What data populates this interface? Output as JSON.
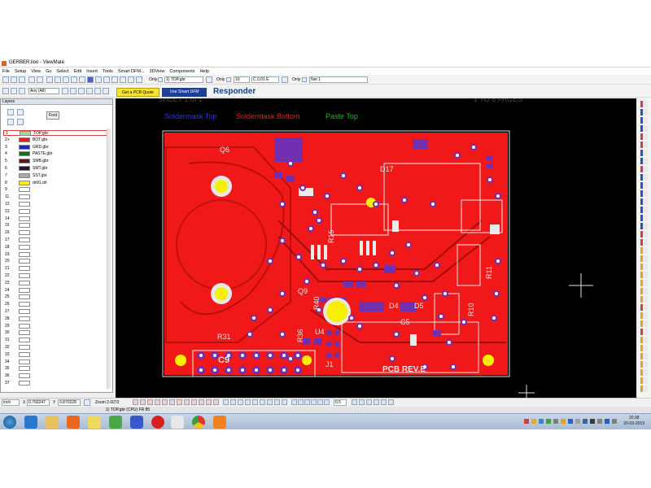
{
  "window": {
    "title": "GERBER.lion - ViewMate"
  },
  "menu": [
    "File",
    "Setup",
    "View",
    "Go",
    "Select",
    "Edit",
    "Insert",
    "Tools",
    "Smart DFM...",
    "3DView",
    "Components",
    "Help"
  ],
  "toolbar": {
    "only_label_1": "Only",
    "layer_combo": "1) TOP.gbr",
    "only_label_2": "Only",
    "d_code": "10",
    "size_value": "C 0.01 E",
    "only_label_3": "Only",
    "net_combo": "Net 1",
    "snap_combo": "Any (All)",
    "pcb_quote": "Get a PCB Quote",
    "smart_dfm": "Use Smart DFM",
    "responder": "Responder"
  },
  "layers_panel": {
    "header": "Layers",
    "font_button": "Font",
    "rows": [
      {
        "num": "1",
        "name": "TOP.gbr",
        "color": "#9ed89e"
      },
      {
        "num": "2+",
        "name": "BOT.gbr",
        "color": "#e02020"
      },
      {
        "num": "3",
        "name": "GRD.gbr",
        "color": "#1828c8"
      },
      {
        "num": "4",
        "name": "PASTE.gbr",
        "color": "#107020"
      },
      {
        "num": "5",
        "name": "SMB.gbr",
        "color": "#5a1818"
      },
      {
        "num": "6",
        "name": "SMT.gbr",
        "color": "#2a1038"
      },
      {
        "num": "7",
        "name": "SST.gbr",
        "color": "#a8a8a8"
      },
      {
        "num": "8",
        "name": "drill1.drl",
        "color": "#f8f000"
      },
      {
        "num": "9",
        "name": "",
        "color": ""
      },
      {
        "num": "11",
        "name": "",
        "color": ""
      },
      {
        "num": "12",
        "name": "",
        "color": ""
      },
      {
        "num": "13",
        "name": "",
        "color": ""
      },
      {
        "num": "14",
        "name": "",
        "color": ""
      },
      {
        "num": "15",
        "name": "",
        "color": ""
      },
      {
        "num": "16",
        "name": "",
        "color": ""
      },
      {
        "num": "17",
        "name": "",
        "color": ""
      },
      {
        "num": "18",
        "name": "",
        "color": ""
      },
      {
        "num": "19",
        "name": "",
        "color": ""
      },
      {
        "num": "20",
        "name": "",
        "color": ""
      },
      {
        "num": "21",
        "name": "",
        "color": ""
      },
      {
        "num": "22",
        "name": "",
        "color": ""
      },
      {
        "num": "23",
        "name": "",
        "color": ""
      },
      {
        "num": "24",
        "name": "",
        "color": ""
      },
      {
        "num": "25",
        "name": "",
        "color": ""
      },
      {
        "num": "26",
        "name": "",
        "color": ""
      },
      {
        "num": "27",
        "name": "",
        "color": ""
      },
      {
        "num": "28",
        "name": "",
        "color": ""
      },
      {
        "num": "29",
        "name": "",
        "color": ""
      },
      {
        "num": "30",
        "name": "",
        "color": ""
      },
      {
        "num": "31",
        "name": "",
        "color": ""
      },
      {
        "num": "32",
        "name": "",
        "color": ""
      },
      {
        "num": "33",
        "name": "",
        "color": ""
      },
      {
        "num": "34",
        "name": "",
        "color": ""
      },
      {
        "num": "35",
        "name": "",
        "color": ""
      },
      {
        "num": "36",
        "name": "",
        "color": ""
      },
      {
        "num": "37",
        "name": "",
        "color": ""
      }
    ]
  },
  "canvas": {
    "label_soldermask_top": "Soldermask Top",
    "label_soldermask_bottom": "Soldermask Bottom",
    "label_paste_top": "Paste Top",
    "pcb_rev": "PCB REV.E",
    "silk_c9": "C9",
    "silk_q6": "Q6",
    "silk_q9": "Q9",
    "silk_r31": "R31",
    "silk_d17": "D17",
    "silk_c5": "C5",
    "silk_d4": "D4",
    "silk_d5": "D5",
    "silk_r15": "R15",
    "silk_r10": "R10",
    "silk_r11": "R11",
    "silk_u4": "U4",
    "silk_j1": "J1",
    "silk_r36": "R36",
    "silk_r40": "R40"
  },
  "statusbar": {
    "units": "inch",
    "x_label": "X",
    "x_value": "0.760247",
    "y_label": "Y",
    "y_value": "0.870228",
    "zoom": "Zoom 2.6073",
    "scale": "0.5"
  },
  "infobar": {
    "text": "1) TOP.gbr (CPU) FR 85"
  },
  "taskbar": {
    "time": "20:38",
    "date": "20-03-2019"
  },
  "colors": {
    "board_red": "#f01818",
    "canvas_bg": "#000000",
    "drill_yellow": "#f8f000",
    "via_purple": "#7030b0",
    "silk_white": "#e8e8e8",
    "label_blue": "#2838ff",
    "label_red": "#f02020",
    "label_green": "#18c018"
  }
}
